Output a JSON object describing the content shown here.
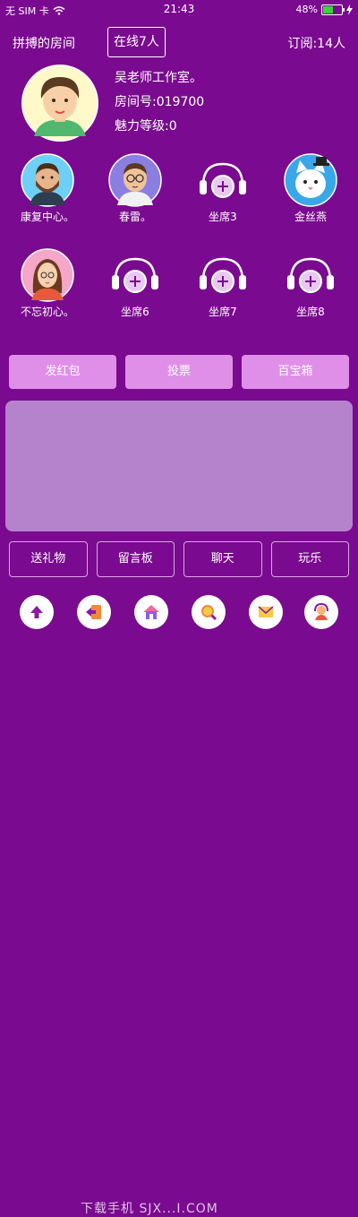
{
  "status": {
    "carrier": "无 SIM 卡",
    "time": "21:43",
    "battery_pct": "48%",
    "battery_level": 0.48
  },
  "header": {
    "title": "拼搏的房间",
    "online": "在线7人",
    "subscribe": "订阅:14人"
  },
  "host": {
    "name": "吴老师工作室。",
    "room_no": "房间号:019700",
    "charm": "魅力等级:0"
  },
  "seats": [
    {
      "label": "康复中心。",
      "avatar": "man-beard-avatar"
    },
    {
      "label": "春雷。",
      "avatar": "man-glasses-avatar"
    },
    {
      "label": "坐席3",
      "avatar": "headphone-add-icon"
    },
    {
      "label": "金丝燕",
      "avatar": "cat-avatar"
    },
    {
      "label": "不忘初心。",
      "avatar": "woman-avatar"
    },
    {
      "label": "坐席6",
      "avatar": "headphone-add-icon"
    },
    {
      "label": "坐席7",
      "avatar": "headphone-add-icon"
    },
    {
      "label": "坐席8",
      "avatar": "headphone-add-icon"
    }
  ],
  "actions": [
    "发红包",
    "投票",
    "百宝箱"
  ],
  "tabs": [
    "送礼物",
    "留言板",
    "聊天",
    "玩乐"
  ],
  "bottom_icons": [
    "arrow-up-icon",
    "exit-icon",
    "home-icon",
    "search-icon",
    "mail-icon",
    "support-icon"
  ],
  "watermark": "下载手机 SJX...I.COM",
  "colors": {
    "background": "#7a0a8f",
    "action_button": "#e08fe9",
    "chat_panel": "#b583cc"
  }
}
